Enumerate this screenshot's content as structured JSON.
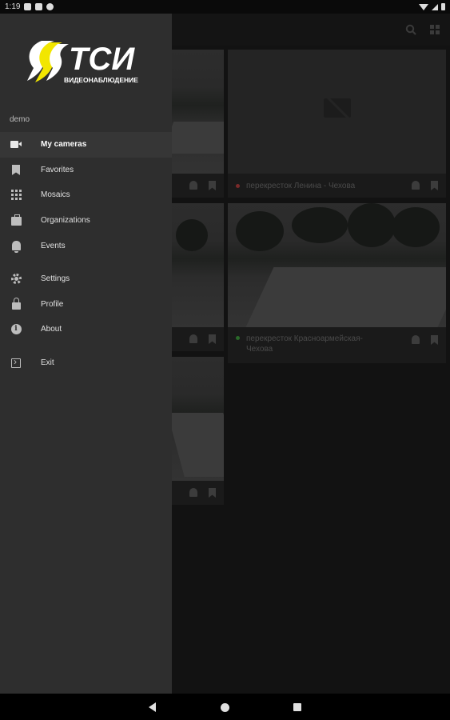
{
  "status_bar": {
    "time": "1:19"
  },
  "drawer": {
    "logo": {
      "brand": "ТСИ",
      "subtitle": "ВИДЕОНАБЛЮДЕНИЕ"
    },
    "account": "demo",
    "items": [
      {
        "label": "My cameras",
        "icon": "camera-icon",
        "active": true
      },
      {
        "label": "Favorites",
        "icon": "bookmark-icon"
      },
      {
        "label": "Mosaics",
        "icon": "grid-icon"
      },
      {
        "label": "Organizations",
        "icon": "briefcase-icon"
      },
      {
        "label": "Events",
        "icon": "bell-icon"
      },
      {
        "label": "Settings",
        "icon": "gear-icon"
      },
      {
        "label": "Profile",
        "icon": "lock-icon"
      },
      {
        "label": "About",
        "icon": "info-icon"
      },
      {
        "label": "Exit",
        "icon": "exit-icon"
      }
    ]
  },
  "cameras": [
    {
      "name": "перекресток Ленина - Чехова",
      "status_color": "#7a2a2a"
    },
    {
      "name": "перекресток Красноармейская-Чехова",
      "status_color": "#2a6a2a"
    }
  ],
  "colors": {
    "drawer_bg": "#2e2e2e",
    "logo_yellow": "#f2e600"
  }
}
